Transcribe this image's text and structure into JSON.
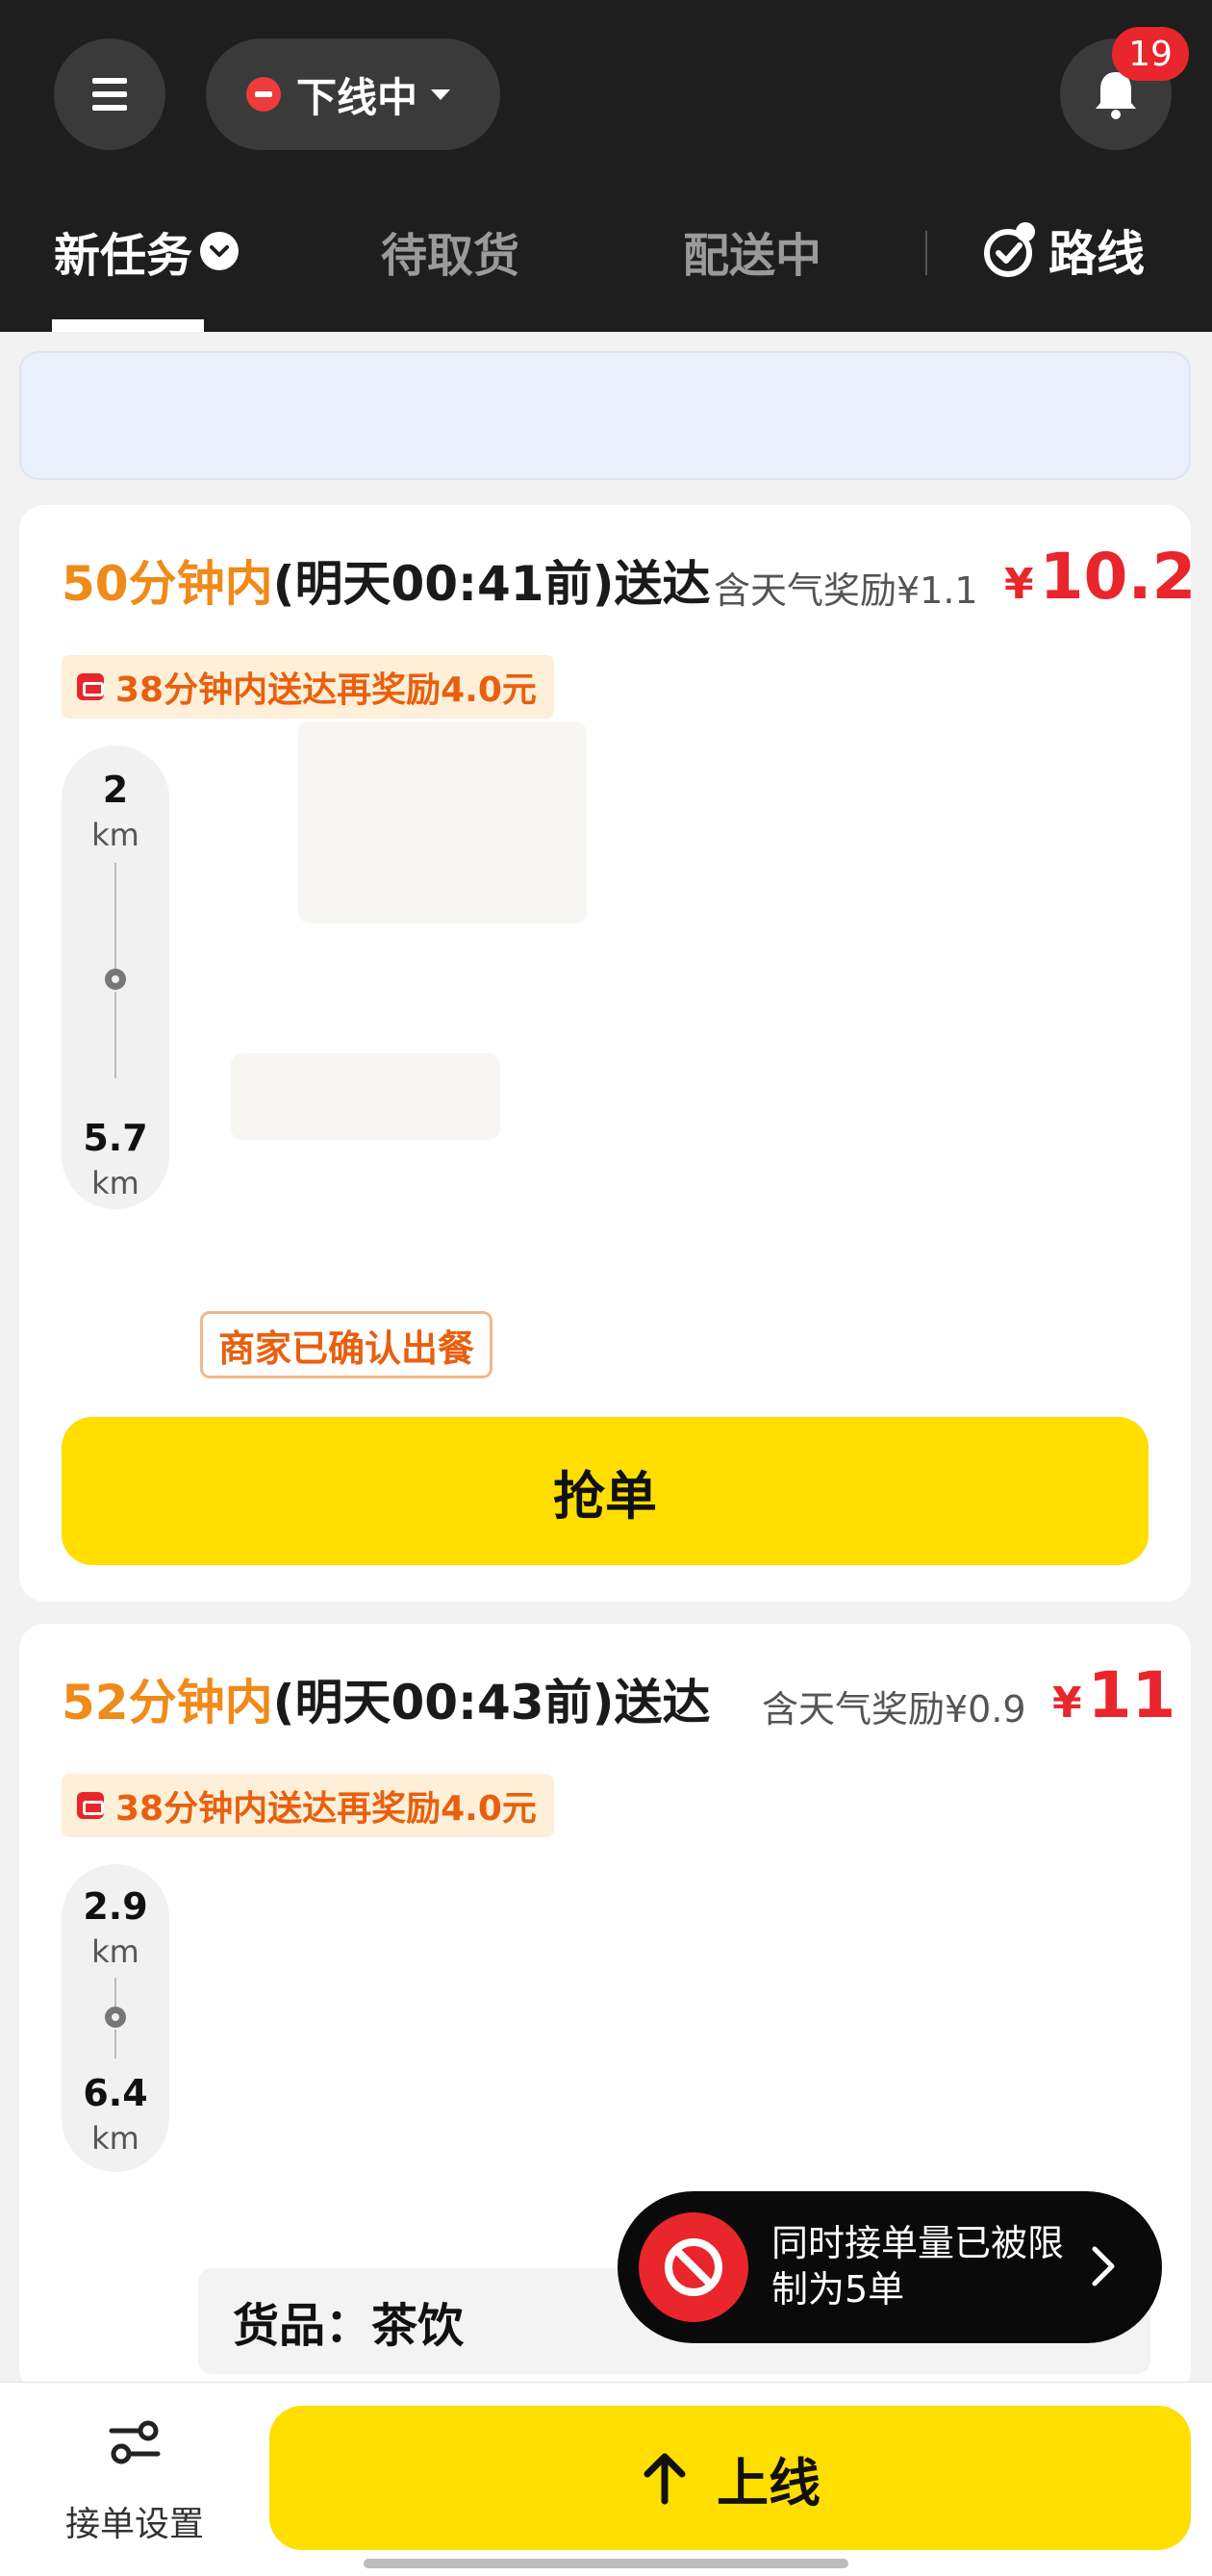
{
  "header": {
    "status_label": "下线中",
    "notification_count": "19"
  },
  "tabs": {
    "new_tasks": "新任务",
    "to_pickup": "待取货",
    "delivering": "配送中",
    "route": "路线"
  },
  "orders": [
    {
      "deliver_highlight": "50分钟内",
      "deliver_rest": "(明天00:41前)送达",
      "weather_bonus": "含天气奖励¥1.1",
      "currency": "¥",
      "price": "10.2",
      "promo": "38分钟内送达再奖励4.0元",
      "distance_from": "2",
      "distance_to": "5.7",
      "distance_unit": "km",
      "merchant_status": "商家已确认出餐",
      "grab_label": "抢单"
    },
    {
      "deliver_highlight": "52分钟内",
      "deliver_rest": "(明天00:43前)送达",
      "weather_bonus": "含天气奖励¥0.9",
      "currency": "¥",
      "price": "11",
      "promo": "38分钟内送达再奖励4.0元",
      "distance_from": "2.9",
      "distance_to": "6.4",
      "distance_unit": "km",
      "goods_label": "货品：茶饮"
    }
  ],
  "toast": {
    "message": "同时接单量已被限制为5单"
  },
  "bottom": {
    "settings_label": "接单设置",
    "online_label": "上线"
  },
  "colors": {
    "header_bg": "#1e1e1e",
    "accent_yellow": "#ffde00",
    "price_red": "#e8262c",
    "highlight_orange": "#f08a18"
  }
}
